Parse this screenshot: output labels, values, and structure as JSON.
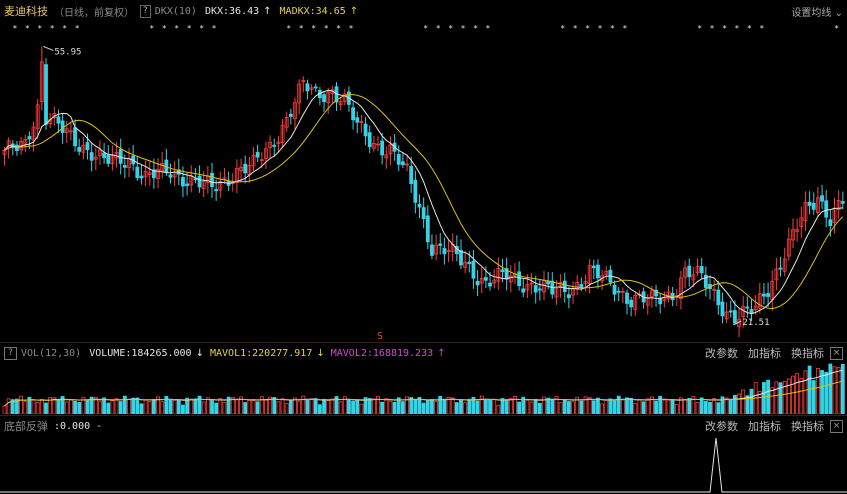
{
  "main_panel": {
    "stock_name": "麦迪科技",
    "period_info": "（日线，前复权）",
    "question_mark": "?",
    "indicator_name": "DKX(10)",
    "dkx_label": "DKX:",
    "dkx_value": "36.43",
    "dkx_arrow": "↑",
    "madkx_label": "MADKX:",
    "madkx_value": "34.65",
    "madkx_arrow": "↑",
    "settings_label": "设置均线",
    "settings_arrow": "⌄",
    "high_label": "55.95",
    "low_label": "21.51",
    "signal_mark": "S"
  },
  "volume_panel": {
    "title": "VOL(12,30)",
    "volume_label": "VOLUME:",
    "volume_value": "184265.000",
    "volume_arrow": "↓",
    "mavol1_label": "MAVOL1:",
    "mavol1_value": "220277.917",
    "mavol1_arrow": "↓",
    "mavol2_label": "MAVOL2:",
    "mavol2_value": "168819.233",
    "mavol2_arrow": "↑",
    "buttons": [
      "改参数",
      "加指标",
      "换指标"
    ],
    "close_label": "×"
  },
  "bottom_panel": {
    "title": "底部反弹",
    "value_text": ":0.000 -",
    "buttons": [
      "改参数",
      "加指标",
      "换指标"
    ],
    "close_label": "×"
  },
  "colors": {
    "up": "#ff3b3b",
    "down": "#35d3e6",
    "dkx": "#e6e6e6",
    "madkx": "#d9c11e",
    "mavol1": "#e6e6e6",
    "mavol2": "#d9c11e",
    "star": "#e6e6e6"
  },
  "chart_data": {
    "type": "candlestick",
    "price_range": [
      21.51,
      55.95
    ],
    "high_marker": 55.95,
    "low_marker": 21.51,
    "series": [
      "DKX",
      "MADKX"
    ],
    "volume_series": [
      "VOLUME",
      "MAVOL1",
      "MAVOL2"
    ]
  }
}
